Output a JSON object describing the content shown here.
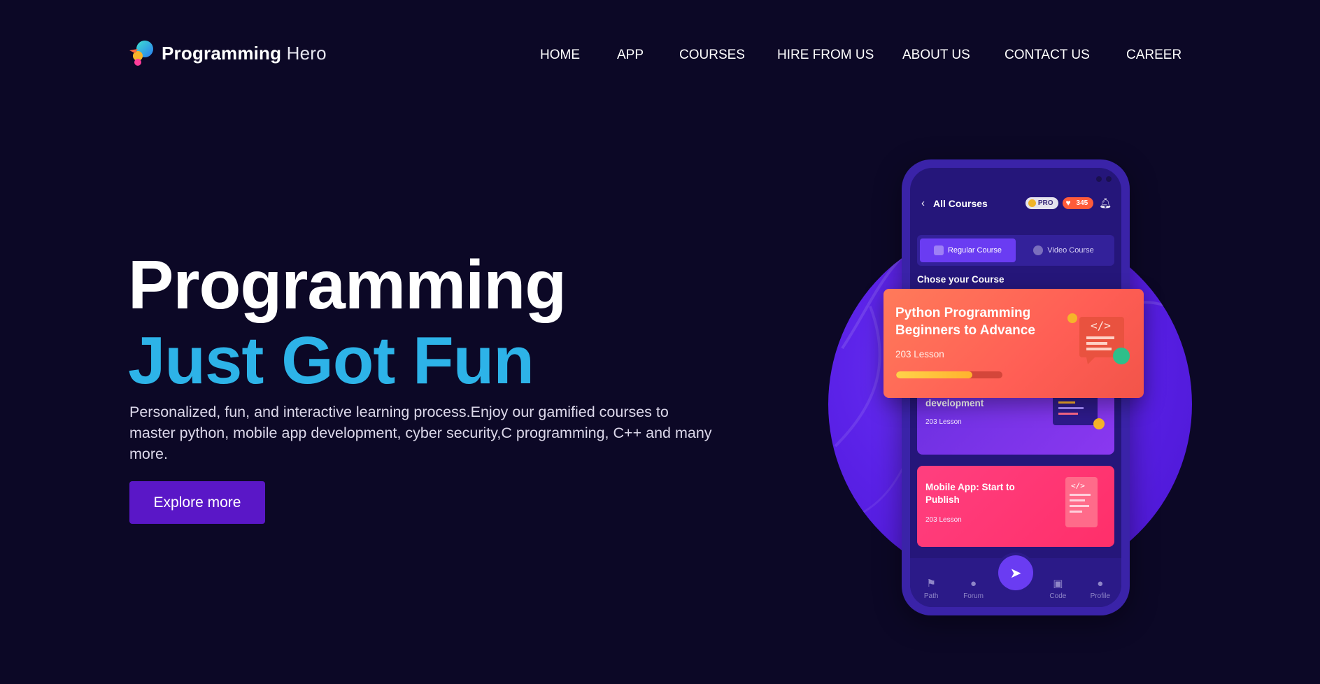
{
  "brand": {
    "name_bold": "Programming",
    "name_light": "Hero"
  },
  "nav": {
    "items": [
      {
        "label": "HOME"
      },
      {
        "label": "APP"
      },
      {
        "label": "COURSES"
      },
      {
        "label": "HIRE FROM US"
      },
      {
        "label": "ABOUT US"
      },
      {
        "label": "CONTACT US"
      },
      {
        "label": "CAREER"
      }
    ]
  },
  "hero": {
    "title_line1": "Programming",
    "title_line2": "Just Got Fun",
    "description": "Personalized, fun, and interactive learning process.Enjoy our gamified courses to master python, mobile app development, cyber security,C programming, C++ and many more.",
    "cta_label": "Explore more",
    "accent_color": "#2db3e8",
    "button_color": "#5a17c7"
  },
  "phone": {
    "header_title": "All Courses",
    "pro_badge": "PRO",
    "gems": "345",
    "tabs": [
      {
        "label": "Regular Course",
        "active": true
      },
      {
        "label": "Video Course",
        "active": false
      }
    ],
    "section_title": "Chose your Course",
    "courses": [
      {
        "title": "Python Programming Beginners to Advance",
        "lessons": "203 Lesson",
        "progress": 0.72
      },
      {
        "title": "Complete Web development",
        "lessons": "203 Lesson"
      },
      {
        "title": "Mobile App: Start to Publish",
        "lessons": "203 Lesson"
      }
    ],
    "bottom_nav": [
      {
        "label": "Path",
        "icon": "flag-icon"
      },
      {
        "label": "Forum",
        "icon": "chat-icon"
      },
      {
        "label": "",
        "icon": "compass-icon"
      },
      {
        "label": "Code",
        "icon": "code-icon"
      },
      {
        "label": "Profile",
        "icon": "user-icon"
      }
    ]
  }
}
